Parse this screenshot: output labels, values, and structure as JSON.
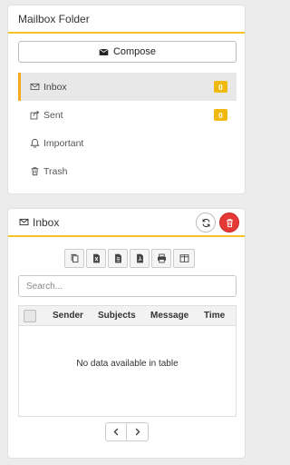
{
  "mailbox": {
    "title": "Mailbox Folder",
    "compose_label": "Compose",
    "folders": [
      {
        "label": "Inbox",
        "icon": "envelope-icon",
        "badge": "0"
      },
      {
        "label": "Sent",
        "icon": "share-icon",
        "badge": "0"
      },
      {
        "label": "Important",
        "icon": "bell-icon",
        "badge": null
      },
      {
        "label": "Trash",
        "icon": "trash-icon",
        "badge": null
      }
    ]
  },
  "inbox": {
    "title": "Inbox",
    "search_placeholder": "Search...",
    "columns": [
      "Sender",
      "Subjects",
      "Message",
      "Time"
    ],
    "empty_text": "No data available in table",
    "export_buttons": [
      "copy-icon",
      "excel-icon",
      "csv-icon",
      "pdf-icon",
      "print-icon",
      "columns-icon"
    ]
  },
  "colors": {
    "accent": "#f4c127",
    "badge": "#f0b90f",
    "delete": "#e53935"
  }
}
